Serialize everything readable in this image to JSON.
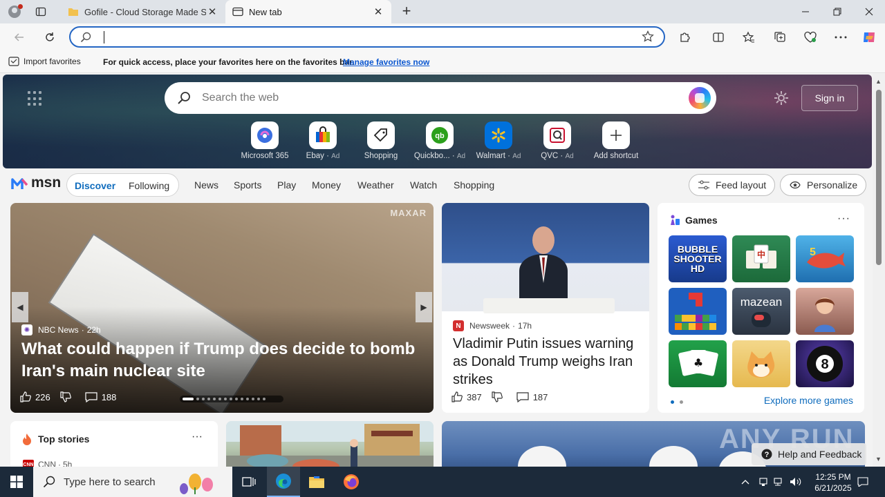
{
  "browser": {
    "tabs": [
      {
        "title": "Gofile - Cloud Storage Made Simple"
      },
      {
        "title": "New tab"
      }
    ],
    "address": {
      "value": "",
      "placeholder": ""
    },
    "favorites_bar": {
      "import_label": "Import favorites",
      "message": "For quick access, place your favorites here on the favorites bar.",
      "link": "Manage favorites now"
    }
  },
  "hero": {
    "search_placeholder": "Search the web",
    "sign_in": "Sign in",
    "shortcuts": [
      {
        "label": "Microsoft 365",
        "ad": ""
      },
      {
        "label": "Ebay",
        "ad": "Ad"
      },
      {
        "label": "Shopping",
        "ad": ""
      },
      {
        "label": "Quickbo...",
        "ad": "Ad"
      },
      {
        "label": "Walmart",
        "ad": "Ad"
      },
      {
        "label": "QVC",
        "ad": "Ad"
      },
      {
        "label": "Add shortcut",
        "ad": ""
      }
    ]
  },
  "msn_nav": {
    "logo": "msn",
    "discover": "Discover",
    "following": "Following",
    "links": [
      "News",
      "Sports",
      "Play",
      "Money",
      "Weather",
      "Watch",
      "Shopping"
    ],
    "feed_layout": "Feed layout",
    "personalize": "Personalize"
  },
  "main_story": {
    "watermark": "MAXAR",
    "source": "NBC News",
    "age": "22h",
    "headline": "What could happen if Trump does decide to bomb Iran's main nuclear site",
    "likes": "226",
    "comments": "188"
  },
  "second_story": {
    "source": "Newsweek",
    "age": "17h",
    "headline": "Vladimir Putin issues warning as Donald Trump weighs Iran strikes",
    "likes": "387",
    "comments": "187"
  },
  "games": {
    "title": "Games",
    "tiles": [
      {
        "label": "BUBBLE SHOOTER HD",
        "color": "#1d4ea8"
      },
      {
        "label": "Mahjong",
        "color": "#2e7d4a"
      },
      {
        "label": "Shark 5",
        "color": "#2b8fd3"
      },
      {
        "label": "Tetris blocks",
        "color": "#1f5fbf"
      },
      {
        "label": "mazean",
        "color": "#3b4a5c"
      },
      {
        "label": "Story",
        "color": "#a7685a"
      },
      {
        "label": "Solitaire",
        "color": "#1d8a3a"
      },
      {
        "label": "Shiba",
        "color": "#e7c46b"
      },
      {
        "label": "8",
        "color": "#3a2a7a"
      }
    ],
    "explore": "Explore more games"
  },
  "top_stories": {
    "title": "Top stories",
    "source": "CNN",
    "age": "5h"
  },
  "help": {
    "label": "Help and Feedback",
    "watermark": "ANY RUN"
  },
  "taskbar": {
    "search_placeholder": "Type here to search",
    "time": "12:25 PM",
    "date": "6/21/2025"
  }
}
